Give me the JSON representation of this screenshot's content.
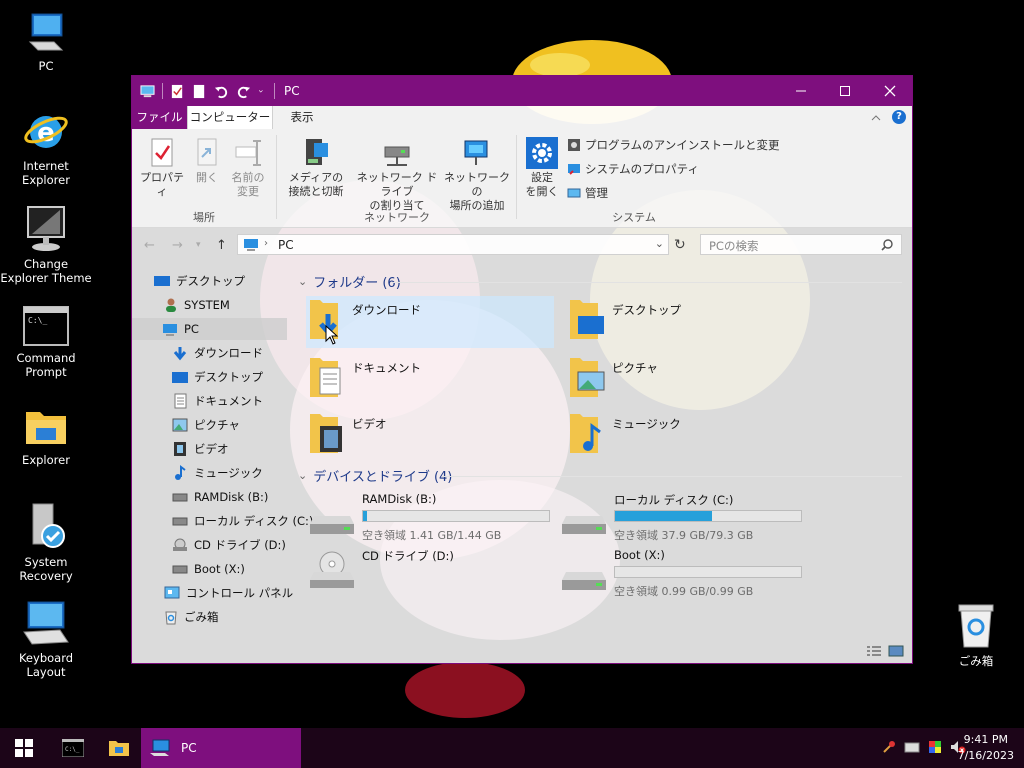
{
  "desktop": {
    "icons": [
      {
        "label": "PC",
        "icon": "computer-icon"
      },
      {
        "label": "Internet Explorer",
        "icon": "internet-explorer-icon"
      },
      {
        "label": "Change Explorer Theme",
        "icon": "monitor-icon"
      },
      {
        "label": "Command Prompt",
        "icon": "console-icon"
      },
      {
        "label": "Explorer",
        "icon": "folder-icon"
      },
      {
        "label": "System Recovery",
        "icon": "recovery-icon"
      },
      {
        "label": "Keyboard Layout",
        "icon": "keyboard-icon"
      }
    ],
    "recycle_bin": "ごみ箱"
  },
  "window": {
    "title": "PC",
    "tabs": {
      "file": "ファイル",
      "computer": "コンピューター",
      "view": "表示"
    },
    "ribbon": {
      "location": {
        "properties": "プロパティ",
        "open": "開く",
        "rename_line1": "名前の",
        "rename_line2": "変更",
        "group": "場所"
      },
      "network": {
        "media_line1": "メディアの",
        "media_line2": "接続と切断",
        "map_line1": "ネットワーク ドライブ",
        "map_line2": "の割り当て",
        "addloc_line1": "ネットワークの",
        "addloc_line2": "場所の追加",
        "group": "ネットワーク"
      },
      "system": {
        "settings_line1": "設定",
        "settings_line2": "を開く",
        "uninstall": "プログラムのアンインストールと変更",
        "sysprops": "システムのプロパティ",
        "manage": "管理",
        "group": "システム"
      }
    },
    "address": {
      "path": "PC",
      "search_placeholder": "PCの検索"
    },
    "nav_pane": [
      "デスクトップ",
      "SYSTEM",
      "PC",
      "ダウンロード",
      "デスクトップ",
      "ドキュメント",
      "ピクチャ",
      "ビデオ",
      "ミュージック",
      "RAMDisk (B:)",
      "ローカル ディスク (C:)",
      "CD ドライブ (D:)",
      "Boot (X:)",
      "コントロール パネル",
      "ごみ箱"
    ],
    "folders_header": "フォルダー (6)",
    "folders": [
      "ダウンロード",
      "デスクトップ",
      "ドキュメント",
      "ピクチャ",
      "ビデオ",
      "ミュージック"
    ],
    "drives_header": "デバイスとドライブ (4)",
    "drives": [
      {
        "name": "RAMDisk (B:)",
        "free": "空き領域 1.41 GB/1.44 GB",
        "used_fraction": 0.02
      },
      {
        "name": "ローカル ディスク (C:)",
        "free": "空き領域 37.9 GB/79.3 GB",
        "used_fraction": 0.52
      },
      {
        "name": "CD ドライブ (D:)"
      },
      {
        "name": "Boot (X:)",
        "free": "空き領域 0.99 GB/0.99 GB",
        "used_fraction": 0.0
      }
    ]
  },
  "taskbar": {
    "active_window": "PC",
    "time": "9:41 PM",
    "date": "7/16/2023"
  },
  "colors": {
    "accent": "#7e0f7e",
    "drive_bar": "#26a0da"
  }
}
